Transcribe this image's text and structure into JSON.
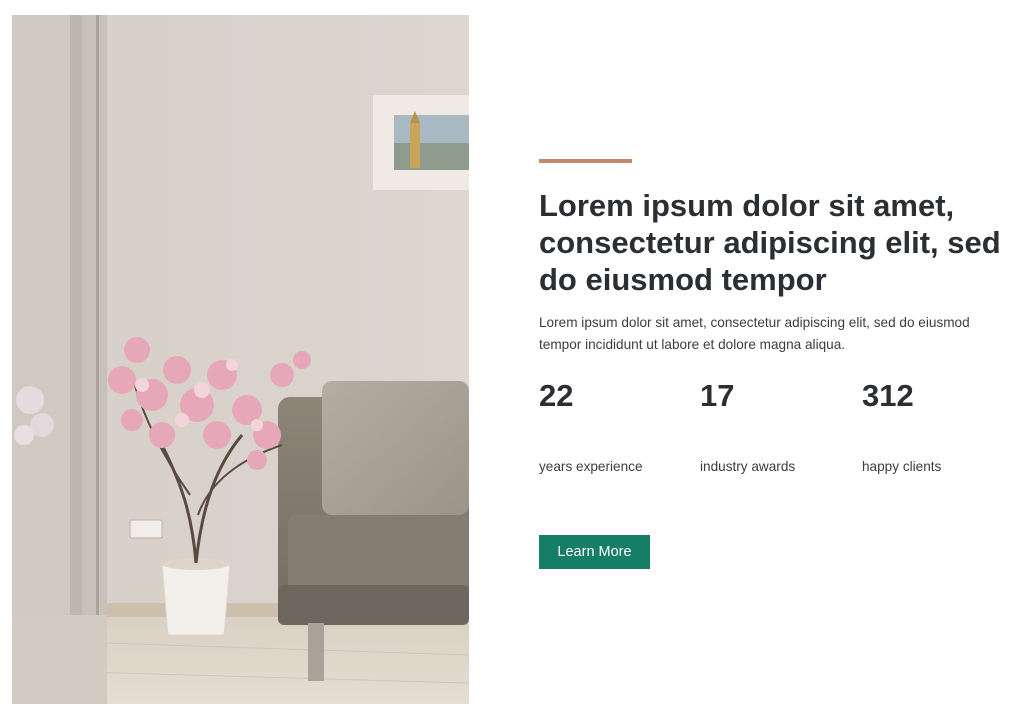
{
  "feature": {
    "heading": "Lorem ipsum dolor sit amet, consectetur adipiscing elit, sed do eiusmod tempor",
    "body": "Lorem ipsum dolor sit amet, consectetur adipiscing elit, sed do eiusmod tempor incididunt ut labore et dolore magna aliqua.",
    "stats": [
      {
        "value": "22",
        "label": "years experience"
      },
      {
        "value": "17",
        "label": "industry awards"
      },
      {
        "value": "312",
        "label": "happy clients"
      }
    ],
    "button_label": "Learn More"
  },
  "colors": {
    "accent_line": "#c4856d",
    "button": "#177e66",
    "heading": "#2b2f33"
  }
}
